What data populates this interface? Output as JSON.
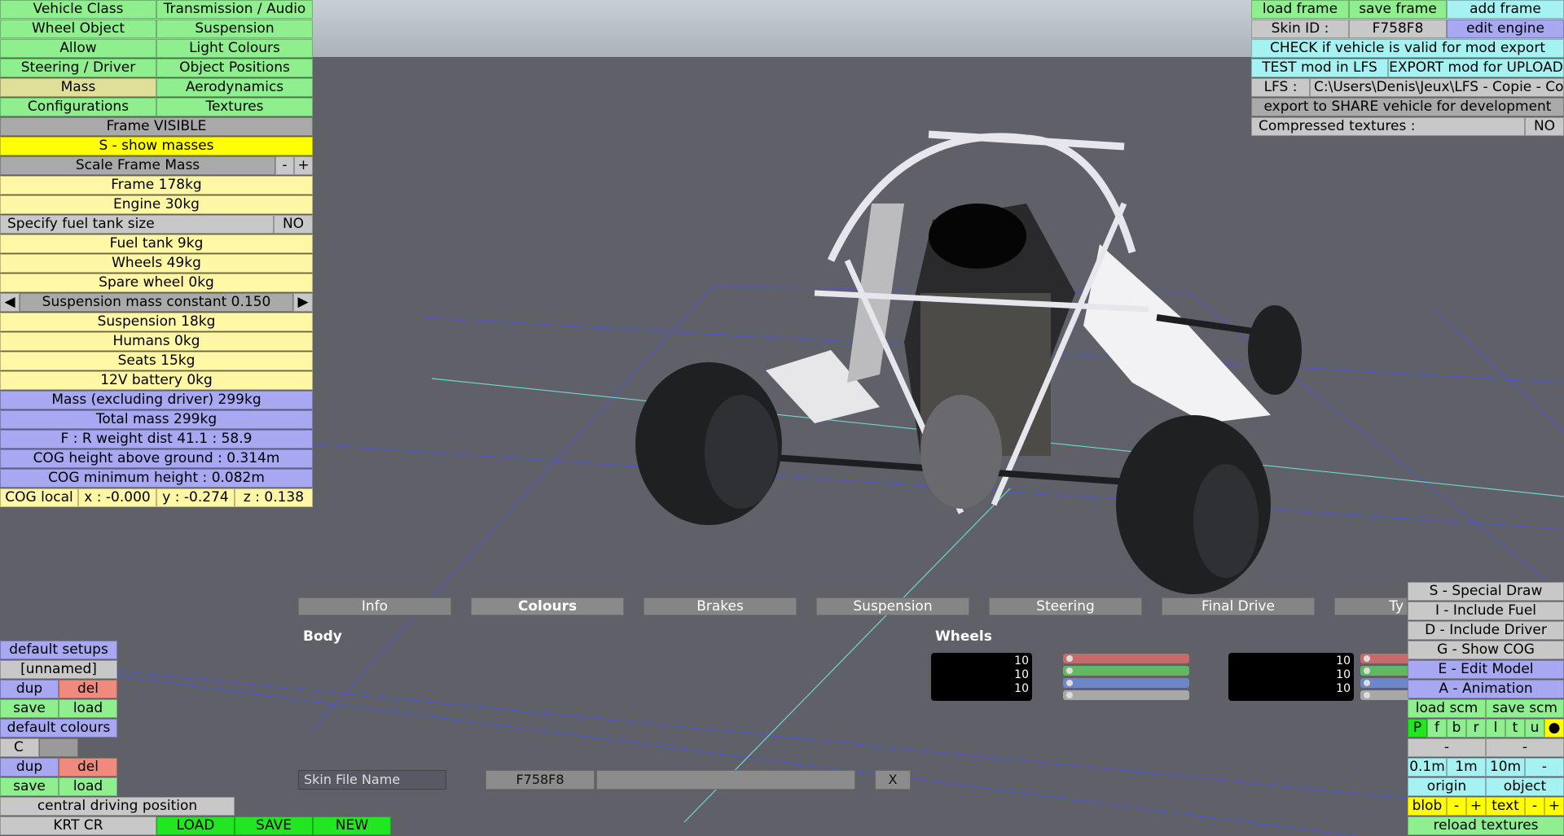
{
  "left_menu": {
    "rows": [
      [
        "Vehicle Class",
        "Transmission / Audio"
      ],
      [
        "Wheel Object",
        "Suspension"
      ],
      [
        "Allow",
        "Light Colours"
      ],
      [
        "Steering / Driver",
        "Object Positions"
      ],
      [
        "Mass",
        "Aerodynamics"
      ],
      [
        "Configurations",
        "Textures"
      ]
    ]
  },
  "mass_panel": {
    "frame_visible": "Frame VISIBLE",
    "show_masses": "S - show masses",
    "scale_frame_mass": "Scale Frame Mass",
    "minus": "-",
    "plus": "+",
    "frame": "Frame 178kg",
    "engine": "Engine 30kg",
    "fuel_tank_size_label": "Specify fuel tank size",
    "fuel_tank_size_value": "NO",
    "fuel_tank": "Fuel tank 9kg",
    "wheels": "Wheels 49kg",
    "spare_wheel": "Spare wheel 0kg",
    "arrow_left": "◀",
    "arrow_right": "▶",
    "suspension_mass_constant": "Suspension mass constant 0.150",
    "suspension": "Suspension 18kg",
    "humans": "Humans 0kg",
    "seats": "Seats 15kg",
    "battery": "12V battery 0kg",
    "mass_excl_driver": "Mass (excluding driver) 299kg",
    "total_mass": "Total mass 299kg",
    "weight_dist": "F : R  weight dist  41.1 : 58.9",
    "cog_height": "COG height above ground : 0.314m",
    "cog_min_height": "COG minimum height : 0.082m",
    "cog_local": "COG local",
    "cog_x": "x : -0.000",
    "cog_y": "y : -0.274",
    "cog_z": "z : 0.138"
  },
  "top_right": {
    "load_frame": "load frame",
    "save_frame": "save frame",
    "add_frame": "add frame",
    "skin_id_label": "Skin ID :",
    "skin_id_value": "F758F8",
    "edit_engine": "edit engine",
    "check_valid": "CHECK if vehicle is valid for mod export",
    "test_mod": "TEST mod in LFS",
    "export_mod": "EXPORT mod for UPLOAD",
    "lfs_label": "LFS :",
    "lfs_path": "C:\\Users\\Denis\\Jeux\\LFS - Copie - Copie",
    "export_share": "export to SHARE vehicle for development",
    "compressed_label": "Compressed textures :",
    "compressed_value": "NO"
  },
  "tabs": [
    "Info",
    "Colours",
    "Brakes",
    "Suspension",
    "Steering",
    "Final Drive",
    "Ty"
  ],
  "active_tab": "Colours",
  "colours_panel": {
    "body_label": "Body",
    "wheels_label": "Wheels",
    "wheel_values_1": [
      "10",
      "10",
      "10"
    ],
    "wheel_values_2": [
      "10",
      "10",
      "10"
    ],
    "skin_file_name_label": "Skin File Name",
    "skin_file_name_value": "F758F8",
    "close": "X"
  },
  "bottom_left": {
    "default_setups": "default setups",
    "unnamed": "[unnamed]",
    "dup": "dup",
    "del": "del",
    "save": "save",
    "load": "load",
    "default_colours": "default colours",
    "c_label": "C",
    "central_driving_position": "central driving position",
    "vehicle_name": "KRT CR",
    "load_btn": "LOAD",
    "save_btn": "SAVE",
    "new_btn": "NEW"
  },
  "bottom_right": {
    "special_draw": "S - Special Draw",
    "include_fuel": "I - Include Fuel",
    "include_driver": "D - Include Driver",
    "show_cog": "G - Show COG",
    "edit_model": "E - Edit Model",
    "animation": "A - Animation",
    "load_scm": "load scm",
    "save_scm": "save scm",
    "letters": [
      "P",
      "f",
      "b",
      "r",
      "l",
      "t",
      "u",
      "●"
    ],
    "dash": "-",
    "scale_01": "0.1m",
    "scale_1": "1m",
    "scale_10": "10m",
    "origin": "origin",
    "object": "object",
    "blob": "blob",
    "text": "text",
    "minus": "-",
    "plus": "+",
    "reload_textures": "reload textures"
  },
  "colors": {
    "sky": "#c9d1d5",
    "ground": "#5f6068",
    "grid_blue": "#4e57c8",
    "grid_cyan": "#6fd6d0",
    "menu_green": "#8fef8f",
    "panel_yellow": "#fff7a6",
    "highlight_yellow": "#ffff00",
    "panel_blue": "#a7a7f2",
    "panel_cyan": "#a6f1f2",
    "delete_red": "#f08a7c"
  }
}
